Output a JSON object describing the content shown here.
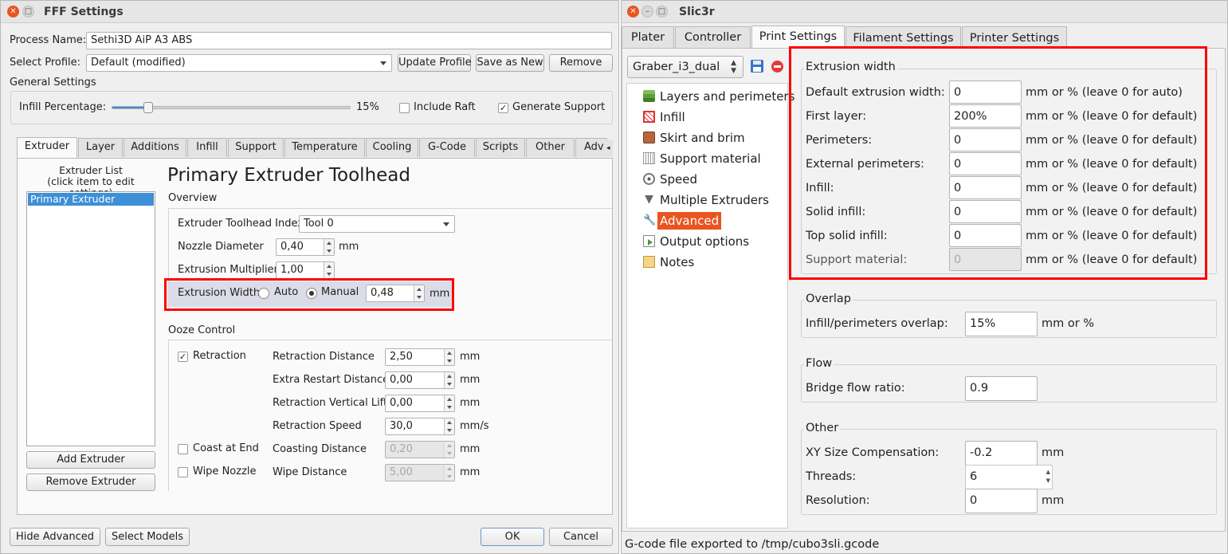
{
  "left_window": {
    "title": "FFF Settings",
    "process_name_label": "Process Name:",
    "process_name_value": "Sethi3D AiP A3 ABS",
    "select_profile_label": "Select Profile:",
    "select_profile_value": "Default (modified)",
    "update_profile": "Update Profile",
    "save_as_new": "Save as New",
    "remove": "Remove",
    "general_settings": "General Settings",
    "infill_percentage_label": "Infill Percentage:",
    "infill_percentage_value": "15%",
    "infill_fraction": 0.15,
    "include_raft": "Include Raft",
    "generate_support": "Generate Support",
    "tabs": [
      "Extruder",
      "Layer",
      "Additions",
      "Infill",
      "Support",
      "Temperature",
      "Cooling",
      "G-Code",
      "Scripts",
      "Other",
      "Adv"
    ],
    "extruder_list_title": "Extruder List\n(click item to edit settings)",
    "extruder_list_items": [
      "Primary Extruder"
    ],
    "add_extruder": "Add Extruder",
    "remove_extruder": "Remove Extruder",
    "panel_title": "Primary Extruder Toolhead",
    "overview": "Overview",
    "toolhead_index_label": "Extruder Toolhead Index",
    "toolhead_index_value": "Tool 0",
    "nozzle_diameter_label": "Nozzle Diameter",
    "nozzle_diameter_value": "0,40",
    "extrusion_multiplier_label": "Extrusion Multiplier",
    "extrusion_multiplier_value": "1,00",
    "extrusion_width_label": "Extrusion Width",
    "auto": "Auto",
    "manual": "Manual",
    "extrusion_width_value": "0,48",
    "mm": "mm",
    "mms": "mm/s",
    "ooze_control": "Ooze Control",
    "retraction": "Retraction",
    "retraction_distance_label": "Retraction Distance",
    "retraction_distance_value": "2,50",
    "extra_restart_label": "Extra Restart Distance",
    "extra_restart_value": "0,00",
    "vertical_lift_label": "Retraction Vertical Lift",
    "vertical_lift_value": "0,00",
    "retraction_speed_label": "Retraction Speed",
    "retraction_speed_value": "30,0",
    "coast_at_end": "Coast at End",
    "coasting_distance_label": "Coasting Distance",
    "coasting_distance_value": "0,20",
    "wipe_nozzle": "Wipe Nozzle",
    "wipe_distance_label": "Wipe Distance",
    "wipe_distance_value": "5,00",
    "hide_advanced": "Hide Advanced",
    "select_models": "Select Models",
    "ok": "OK",
    "cancel": "Cancel"
  },
  "right_window": {
    "title": "Slic3r",
    "tabs": [
      "Plater",
      "Controller",
      "Print Settings",
      "Filament Settings",
      "Printer Settings"
    ],
    "preset": "Graber_i3_dual",
    "tree": [
      {
        "label": "Layers and perimeters",
        "icon": "layers-icon"
      },
      {
        "label": "Infill",
        "icon": "infill-icon"
      },
      {
        "label": "Skirt and brim",
        "icon": "skirt-icon"
      },
      {
        "label": "Support material",
        "icon": "support-icon"
      },
      {
        "label": "Speed",
        "icon": "speed-icon"
      },
      {
        "label": "Multiple Extruders",
        "icon": "funnel-icon"
      },
      {
        "label": "Advanced",
        "icon": "wrench-icon"
      },
      {
        "label": "Output options",
        "icon": "output-icon"
      },
      {
        "label": "Notes",
        "icon": "notes-icon"
      }
    ],
    "extrusion_width": {
      "title": "Extrusion width",
      "rows": [
        {
          "label": "Default extrusion width:",
          "value": "0",
          "unit": "mm or % (leave 0 for auto)"
        },
        {
          "label": "First layer:",
          "value": "200%",
          "unit": "mm or % (leave 0 for default)"
        },
        {
          "label": "Perimeters:",
          "value": "0",
          "unit": "mm or % (leave 0 for default)"
        },
        {
          "label": "External perimeters:",
          "value": "0",
          "unit": "mm or % (leave 0 for default)"
        },
        {
          "label": "Infill:",
          "value": "0",
          "unit": "mm or % (leave 0 for default)"
        },
        {
          "label": "Solid infill:",
          "value": "0",
          "unit": "mm or % (leave 0 for default)"
        },
        {
          "label": "Top solid infill:",
          "value": "0",
          "unit": "mm or % (leave 0 for default)"
        },
        {
          "label": "Support material:",
          "value": "0",
          "unit": "mm or % (leave 0 for default)"
        }
      ]
    },
    "overlap": {
      "title": "Overlap",
      "label": "Infill/perimeters overlap:",
      "value": "15%",
      "unit": "mm or %"
    },
    "flow": {
      "title": "Flow",
      "label": "Bridge flow ratio:",
      "value": "0.9"
    },
    "other": {
      "title": "Other",
      "xy_label": "XY Size Compensation:",
      "xy_value": "-0.2",
      "xy_unit": "mm",
      "threads_label": "Threads:",
      "threads_value": "6",
      "resolution_label": "Resolution:",
      "resolution_value": "0",
      "resolution_unit": "mm"
    },
    "status": "G-code file exported to /tmp/cubo3sli.gcode"
  },
  "colors": {
    "highlight_red": "#ff0000",
    "selection_blue": "#3d8fd6",
    "selection_orange": "#e95420"
  }
}
